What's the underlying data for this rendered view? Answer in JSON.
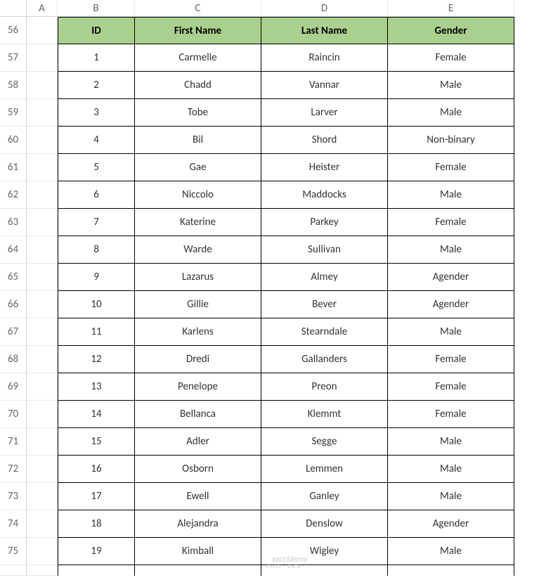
{
  "columns": [
    "A",
    "B",
    "C",
    "D",
    "E"
  ],
  "startRow": 56,
  "headerRow": {
    "B": "ID",
    "C": "First Name",
    "D": "Last Name",
    "E": "Gender"
  },
  "chart_data": {
    "type": "table",
    "title": "",
    "columns": [
      "ID",
      "First Name",
      "Last Name",
      "Gender"
    ],
    "rows": [
      [
        1,
        "Carmelle",
        "Raincin",
        "Female"
      ],
      [
        2,
        "Chadd",
        "Vannar",
        "Male"
      ],
      [
        3,
        "Tobe",
        "Larver",
        "Male"
      ],
      [
        4,
        "Bil",
        "Shord",
        "Non-binary"
      ],
      [
        5,
        "Gae",
        "Heister",
        "Female"
      ],
      [
        6,
        "Niccolo",
        "Maddocks",
        "Male"
      ],
      [
        7,
        "Katerine",
        "Parkey",
        "Female"
      ],
      [
        8,
        "Warde",
        "Sullivan",
        "Male"
      ],
      [
        9,
        "Lazarus",
        "Almey",
        "Agender"
      ],
      [
        10,
        "Gillie",
        "Bever",
        "Agender"
      ],
      [
        11,
        "Karlens",
        "Stearndale",
        "Male"
      ],
      [
        12,
        "Dredi",
        "Gallanders",
        "Female"
      ],
      [
        13,
        "Penelope",
        "Preon",
        "Female"
      ],
      [
        14,
        "Bellanca",
        "Klemmt",
        "Female"
      ],
      [
        15,
        "Adler",
        "Segge",
        "Male"
      ],
      [
        16,
        "Osborn",
        "Lemmen",
        "Male"
      ],
      [
        17,
        "Ewell",
        "Ganley",
        "Male"
      ],
      [
        18,
        "Alejandra",
        "Denslow",
        "Agender"
      ],
      [
        19,
        "Kimball",
        "Wigley",
        "Male"
      ]
    ]
  },
  "watermark": {
    "main": "exceldemy",
    "sub": "EXCEL · DATA · ..."
  },
  "colors": {
    "headerFill": "#a9d08e",
    "border": "#000000"
  }
}
